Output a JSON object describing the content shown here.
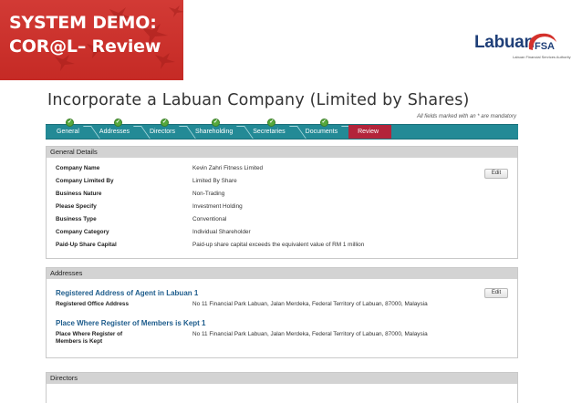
{
  "slide": {
    "title_line1": "SYSTEM DEMO:",
    "title_line2": "COR@L– Review",
    "banner_color": "#c52a25",
    "logo_text": "Labuan",
    "logo_suffix": "FSA",
    "logo_subtitle": "Labuan Financial Services Authority"
  },
  "page": {
    "title": "Incorporate a Labuan Company (Limited by Shares)",
    "mandatory_note": "All fields marked with an * are mandatory"
  },
  "steps": [
    {
      "label": "General",
      "done": true
    },
    {
      "label": "Addresses",
      "done": true
    },
    {
      "label": "Directors",
      "done": true
    },
    {
      "label": "Shareholding",
      "done": true
    },
    {
      "label": "Secretaries",
      "done": true
    },
    {
      "label": "Documents",
      "done": true
    },
    {
      "label": "Review",
      "active": true
    }
  ],
  "general": {
    "header": "General Details",
    "edit": "Edit",
    "fields": [
      {
        "label": "Company Name",
        "value": "Kevin Zahri Fitness Limited"
      },
      {
        "label": "Company Limited By",
        "value": "Limited By Share"
      },
      {
        "label": "Business Nature",
        "value": "Non-Trading"
      },
      {
        "label": "Please Specify",
        "value": "Investment Holding"
      },
      {
        "label": "Business Type",
        "value": "Conventional"
      },
      {
        "label": "Company Category",
        "value": "Individual Shareholder"
      },
      {
        "label": "Paid-Up Share Capital",
        "value": "Paid-up share capital exceeds the equivalent value of RM 1 million"
      }
    ]
  },
  "addresses": {
    "header": "Addresses",
    "edit": "Edit",
    "agent_heading": "Registered Address of Agent in Labuan 1",
    "agent_label": "Registered Office Address",
    "agent_value": "No 11 Financial Park Labuan, Jalan Merdeka, Federal Territory of Labuan, 87000, Malaysia",
    "register_heading": "Place Where Register of Members is Kept 1",
    "register_label_1": "Place Where Register of",
    "register_label_2": "Members is Kept",
    "register_value": "No 11 Financial Park Labuan, Jalan Merdeka, Federal Territory of Labuan, 87000, Malaysia"
  },
  "directors": {
    "header": "Directors"
  }
}
